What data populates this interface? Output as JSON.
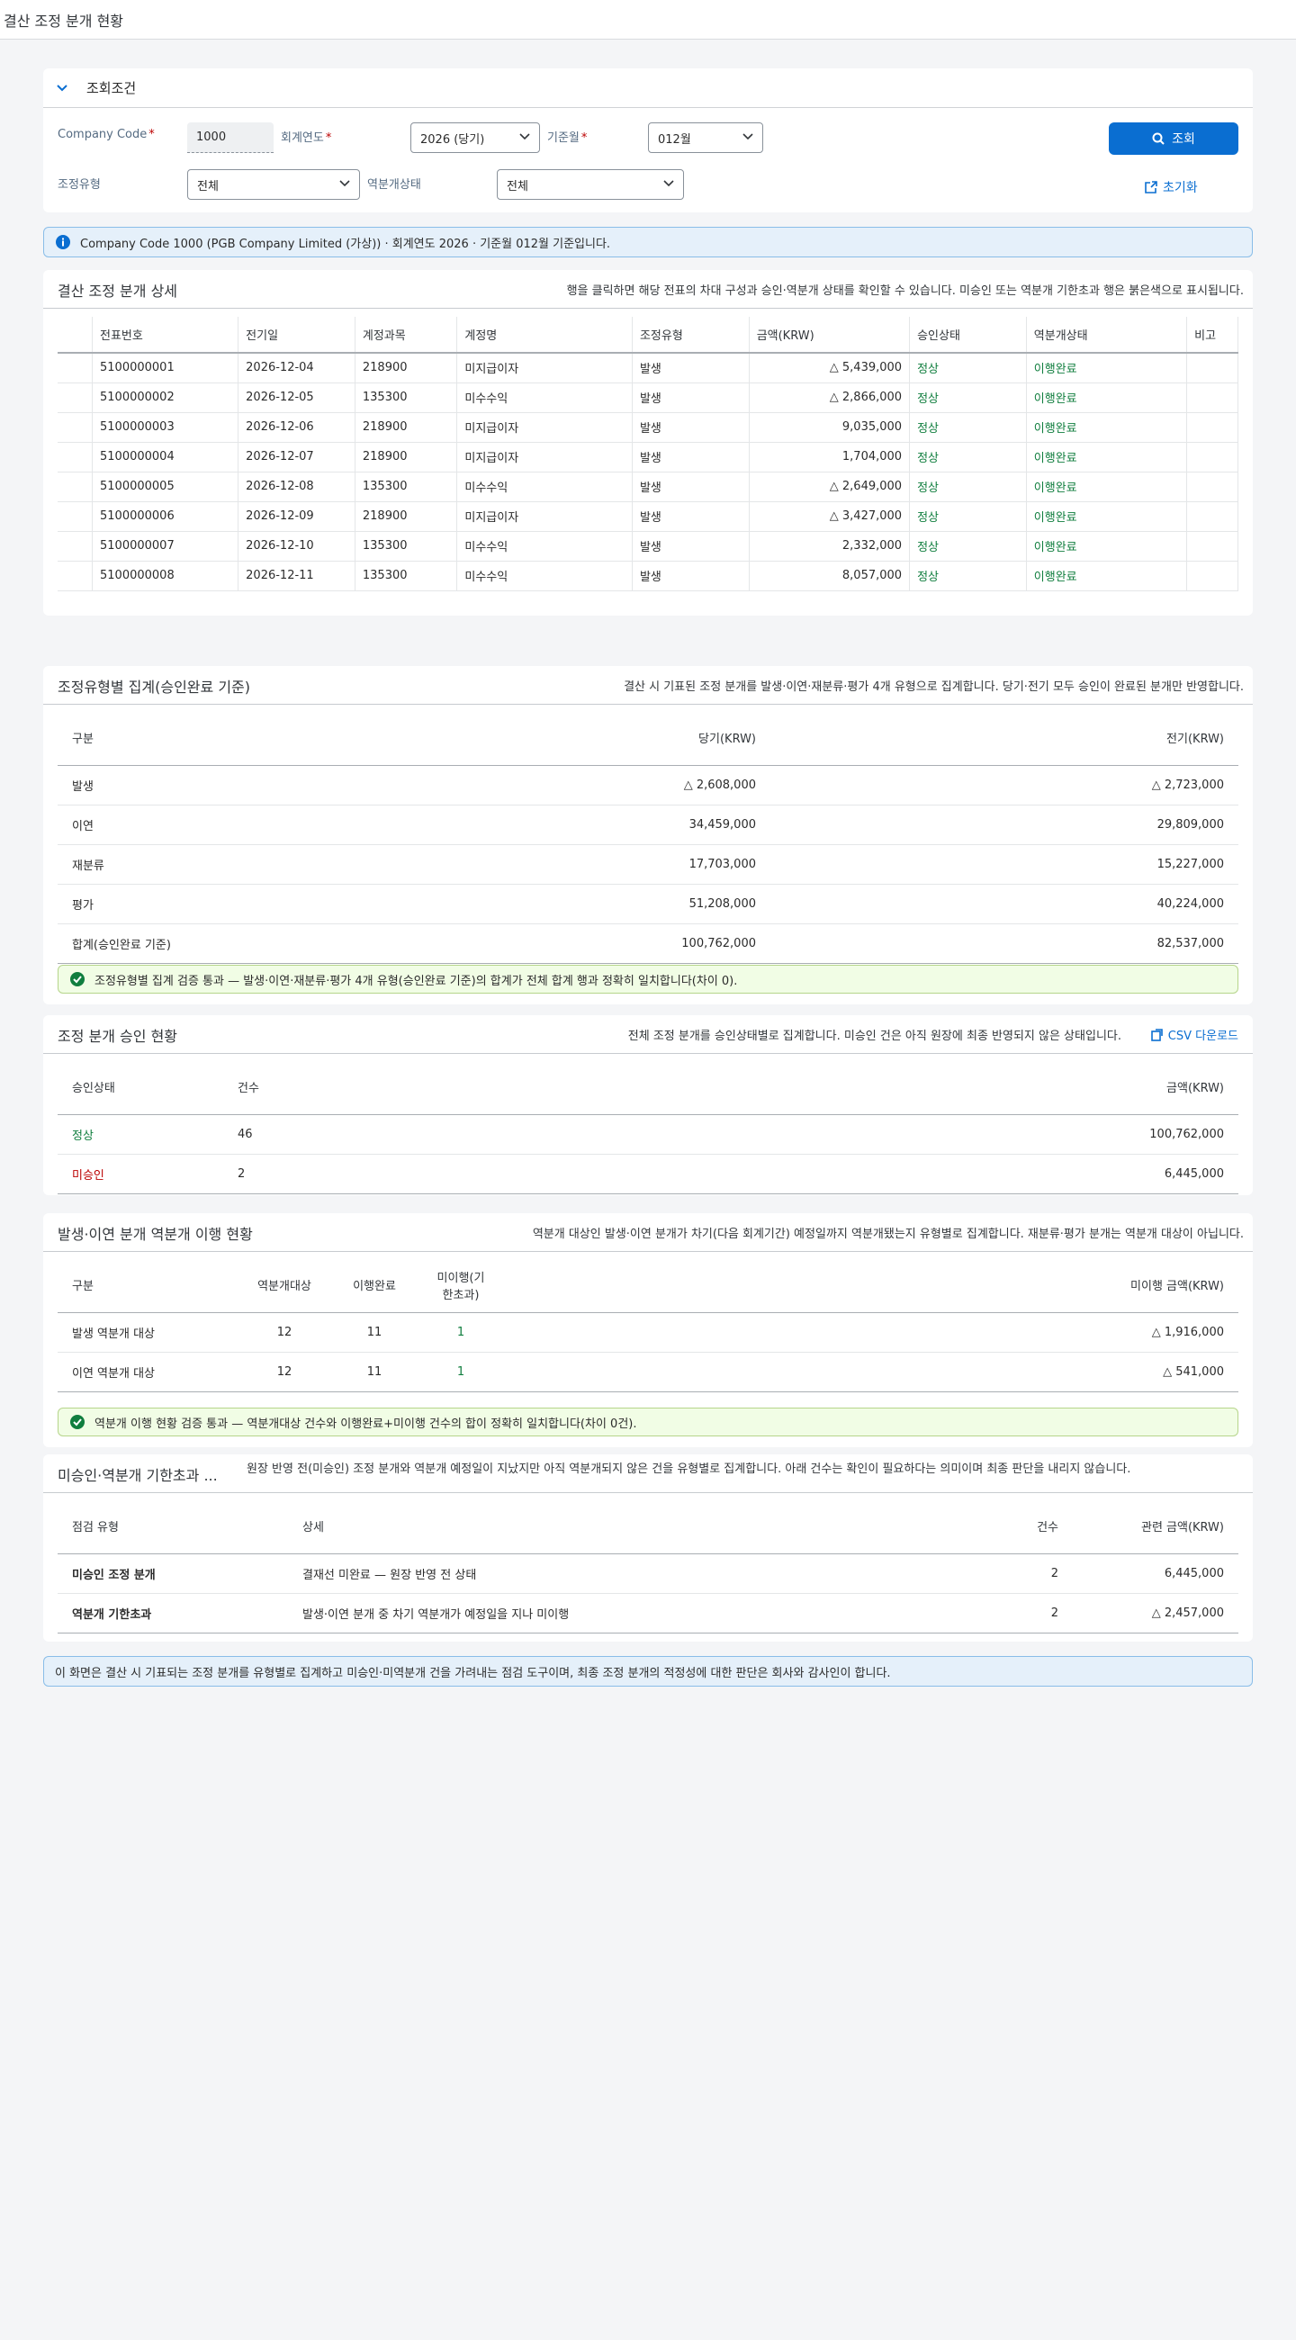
{
  "app_title": "결산 조정 분개 현황",
  "filter": {
    "title": "조회조건",
    "company_code_label": "Company Code",
    "company_code_value": "1000",
    "fiscal_year_label": "회계연도",
    "fiscal_year_value": "2026 (당기)",
    "period_label": "기준월",
    "period_value": "012월",
    "adj_type_label": "조정유형",
    "adj_type_value": "전체",
    "reversal_label": "역분개상태",
    "reversal_value": "전체",
    "search_label": "조회",
    "reset_label": "초기화"
  },
  "info_message": "Company Code 1000 (PGB Company Limited (가상)) · 회계연도 2026 · 기준월 012월 기준입니다.",
  "detail": {
    "title": "결산 조정 분개 상세",
    "desc": "행을 클릭하면 해당 전표의 차대 구성과 승인·역분개 상태를 확인할 수 있습니다. 미승인 또는 역분개 기한초과 행은 붉은색으로 표시됩니다.",
    "columns": [
      "전표번호",
      "전기일",
      "계정과목",
      "계정명",
      "조정유형",
      "금액(KRW)",
      "승인상태",
      "역분개상태",
      "비고"
    ],
    "rows": [
      {
        "doc": "5100000001",
        "date": "2026-12-04",
        "account": "218900",
        "name": "미지급이자",
        "type": "발생",
        "amount": "△ 5,439,000",
        "approval": "정상",
        "reversal": "이행완료",
        "note": ""
      },
      {
        "doc": "5100000002",
        "date": "2026-12-05",
        "account": "135300",
        "name": "미수수익",
        "type": "발생",
        "amount": "△ 2,866,000",
        "approval": "정상",
        "reversal": "이행완료",
        "note": ""
      },
      {
        "doc": "5100000003",
        "date": "2026-12-06",
        "account": "218900",
        "name": "미지급이자",
        "type": "발생",
        "amount": "9,035,000",
        "approval": "정상",
        "reversal": "이행완료",
        "note": ""
      },
      {
        "doc": "5100000004",
        "date": "2026-12-07",
        "account": "218900",
        "name": "미지급이자",
        "type": "발생",
        "amount": "1,704,000",
        "approval": "정상",
        "reversal": "이행완료",
        "note": ""
      },
      {
        "doc": "5100000005",
        "date": "2026-12-08",
        "account": "135300",
        "name": "미수수익",
        "type": "발생",
        "amount": "△ 2,649,000",
        "approval": "정상",
        "reversal": "이행완료",
        "note": ""
      },
      {
        "doc": "5100000006",
        "date": "2026-12-09",
        "account": "218900",
        "name": "미지급이자",
        "type": "발생",
        "amount": "△ 3,427,000",
        "approval": "정상",
        "reversal": "이행완료",
        "note": ""
      },
      {
        "doc": "5100000007",
        "date": "2026-12-10",
        "account": "135300",
        "name": "미수수익",
        "type": "발생",
        "amount": "2,332,000",
        "approval": "정상",
        "reversal": "이행완료",
        "note": ""
      },
      {
        "doc": "5100000008",
        "date": "2026-12-11",
        "account": "135300",
        "name": "미수수익",
        "type": "발생",
        "amount": "8,057,000",
        "approval": "정상",
        "reversal": "이행완료",
        "note": ""
      }
    ]
  },
  "by_type": {
    "title": "조정유형별 집계(승인완료 기준)",
    "desc": "결산 시 기표된 조정 분개를 발생·이연·재분류·평가 4개 유형으로 집계합니다. 당기·전기 모두 승인이 완료된 분개만 반영합니다.",
    "columns": [
      "구분",
      "당기(KRW)",
      "전기(KRW)"
    ],
    "rows": [
      {
        "label": "발생",
        "cur": "△ 2,608,000",
        "prev": "△ 2,723,000"
      },
      {
        "label": "이연",
        "cur": "34,459,000",
        "prev": "29,809,000"
      },
      {
        "label": "재분류",
        "cur": "17,703,000",
        "prev": "15,227,000"
      },
      {
        "label": "평가",
        "cur": "51,208,000",
        "prev": "40,224,000"
      },
      {
        "label": "합계(승인완료 기준)",
        "cur": "100,762,000",
        "prev": "82,537,000"
      }
    ],
    "check_msg": "조정유형별 집계 검증 통과 — 발생·이연·재분류·평가 4개 유형(승인완료 기준)의 합계가 전체 합계 행과 정확히 일치합니다(차이 0)."
  },
  "approval": {
    "title": "조정 분개 승인 현황",
    "desc": "전체 조정 분개를 승인상태별로 집계합니다. 미승인 건은 아직 원장에 최종 반영되지 않은 상태입니다.",
    "csv_label": "CSV 다운로드",
    "columns": [
      "승인상태",
      "건수",
      "금액(KRW)"
    ],
    "rows": [
      {
        "status": "정상",
        "count": "46",
        "amount": "100,762,000"
      },
      {
        "status": "미승인",
        "count": "2",
        "amount": "6,445,000"
      }
    ]
  },
  "reversal": {
    "title": "발생·이연 분개 역분개 이행 현황",
    "desc": "역분개 대상인 발생·이연 분개가 차기(다음 회계기간) 예정일까지 역분개됐는지 유형별로 집계합니다. 재분류·평가 분개는 역분개 대상이 아닙니다.",
    "columns": [
      "구분",
      "역분개대상",
      "이행완료",
      "미이행(기한초과)",
      "미이행 금액(KRW)"
    ],
    "rows": [
      {
        "label": "발생 역분개 대상",
        "target": "12",
        "done": "11",
        "pending": "1",
        "amount": "△ 1,916,000"
      },
      {
        "label": "이연 역분개 대상",
        "target": "12",
        "done": "11",
        "pending": "1",
        "amount": "△ 541,000"
      }
    ],
    "check_msg": "역분개 이행 현황 검증 통과 — 역분개대상 건수와 이행완료+미이행 건수의 합이 정확히 일치합니다(차이 0건)."
  },
  "exceptions": {
    "title": "미승인·역분개 기한초과 ...",
    "desc": "원장 반영 전(미승인) 조정 분개와 역분개 예정일이 지났지만 아직 역분개되지 않은 건을 유형별로 집계합니다. 아래 건수는 확인이 필요하다는 의미이며 최종 판단을 내리지 않습니다.",
    "columns": [
      "점검 유형",
      "상세",
      "건수",
      "관련 금액(KRW)"
    ],
    "rows": [
      {
        "type": "미승인 조정 분개",
        "detail": "결재선 미완료 — 원장 반영 전 상태",
        "count": "2",
        "amount": "6,445,000"
      },
      {
        "type": "역분개 기한초과",
        "detail": "발생·이연 분개 중 차기 역분개가 예정일을 지나 미이행",
        "count": "2",
        "amount": "△ 2,457,000"
      }
    ]
  },
  "footer_note": "이 화면은 결산 시 기표되는 조정 분개를 유형별로 집계하고 미승인·미역분개 건을 가려내는 점검 도구이며, 최종 조정 분개의 적정성에 대한 판단은 회사와 감사인이 합니다."
}
